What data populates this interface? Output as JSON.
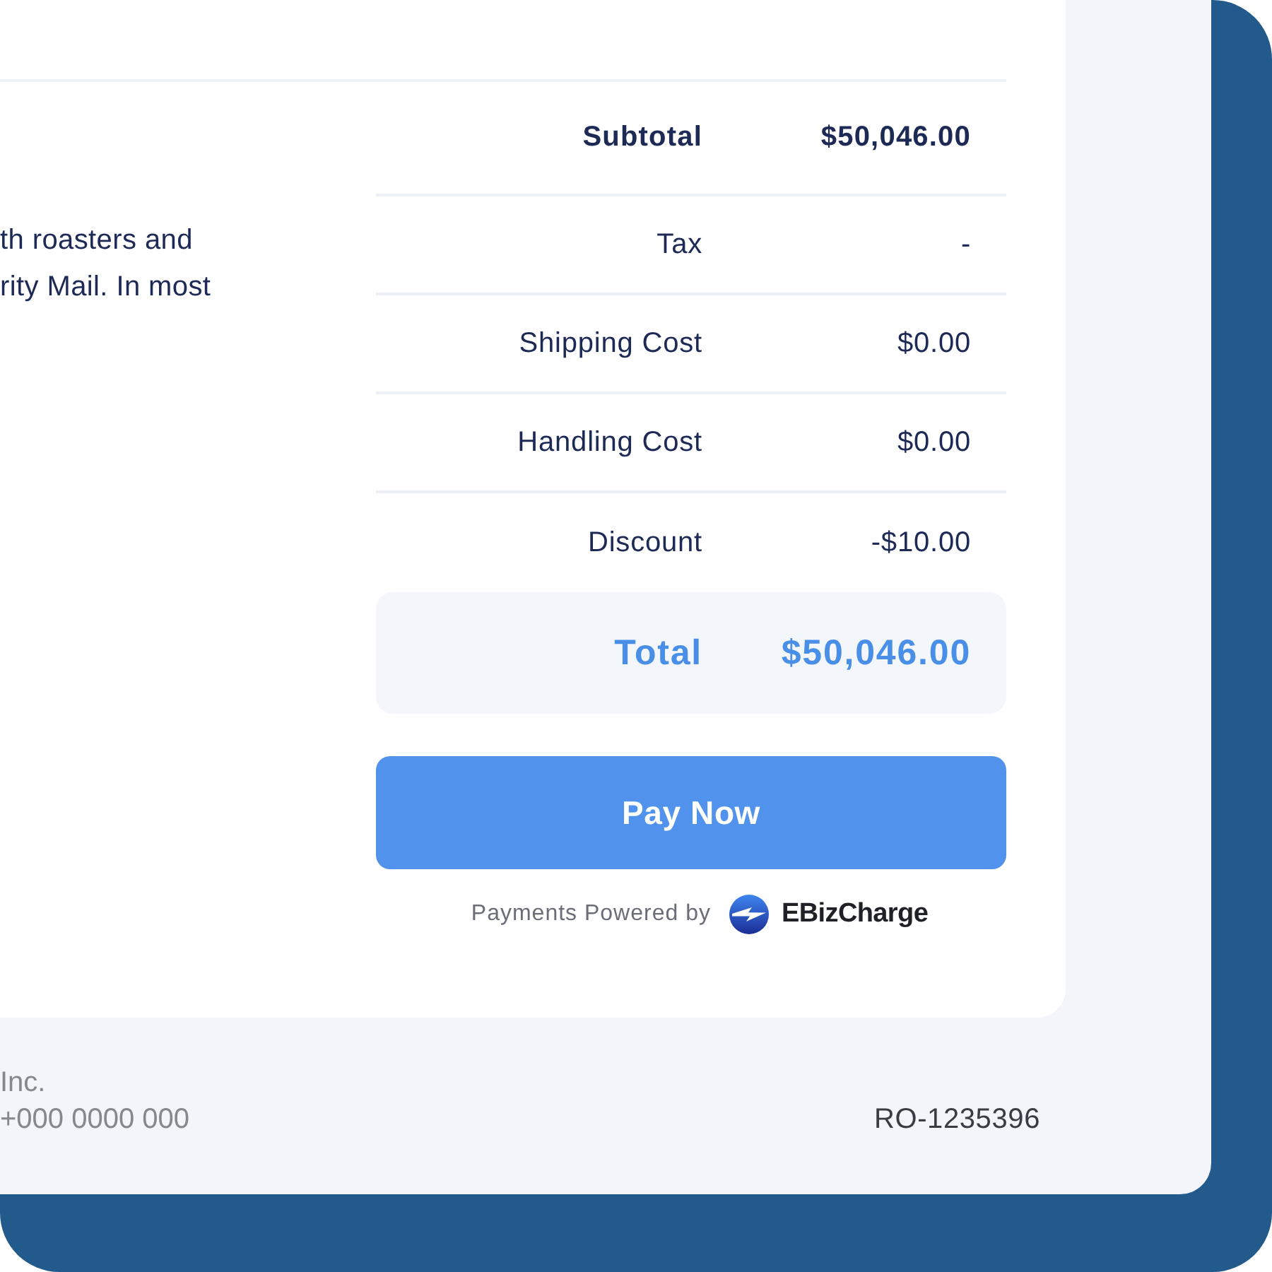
{
  "note_lines": [
    "th roasters and",
    "rity Mail. In most"
  ],
  "summary": {
    "rows": [
      {
        "kind": "subtotal",
        "label": "Subtotal",
        "value": "$50,046.00"
      },
      {
        "kind": "line",
        "label": "Tax",
        "value": "-"
      },
      {
        "kind": "line",
        "label": "Shipping Cost",
        "value": "$0.00"
      },
      {
        "kind": "line",
        "label": "Handling Cost",
        "value": "$0.00"
      },
      {
        "kind": "line",
        "label": "Discount",
        "value": "-$10.00"
      }
    ],
    "total": {
      "label": "Total",
      "value": "$50,046.00"
    }
  },
  "pay_button": "Pay Now",
  "powered_by": {
    "text": "Payments Powered by",
    "brand": "EBizCharge"
  },
  "footer": {
    "company_lines": [
      "Inc.",
      "+000 0000 000"
    ],
    "reference": "RO-1235396"
  }
}
